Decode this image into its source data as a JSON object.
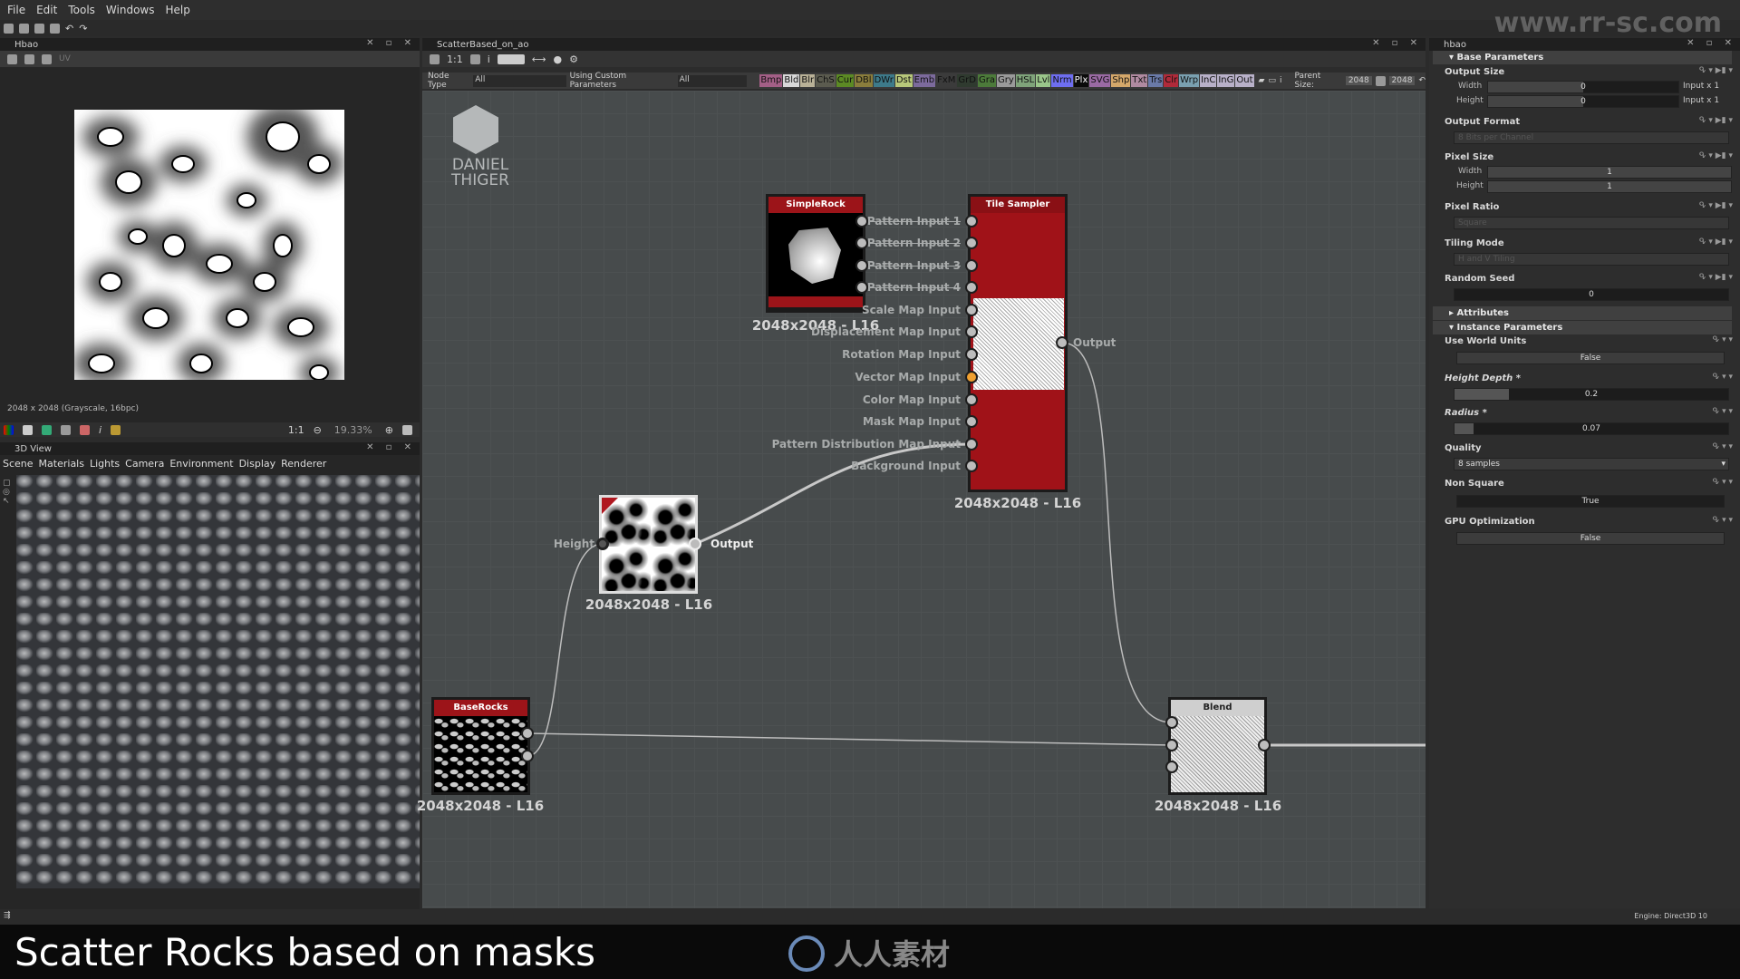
{
  "menu": [
    "File",
    "Edit",
    "Tools",
    "Windows",
    "Help"
  ],
  "left_panel": {
    "title": "Hbao",
    "toolbar_uv": "UV",
    "image_info": "2048 x 2048 (Grayscale, 16bpc)",
    "zoom_ratio": "1:1",
    "zoom_level": "19.33%"
  },
  "view3d": {
    "title": "3D View",
    "menu": [
      "Scene",
      "Materials",
      "Lights",
      "Camera",
      "Environment",
      "Display",
      "Renderer"
    ]
  },
  "graph": {
    "title": "ScatterBased_on_ao",
    "toolbar_ratio": "1:1",
    "node_type_label": "Node Type",
    "node_type_value": "All",
    "custom_params_label": "Using Custom Parameters",
    "custom_params_value": "All",
    "filters": [
      {
        "t": "Bmp",
        "c": "#a35f86"
      },
      {
        "t": "Bld",
        "c": "#d8d8d8"
      },
      {
        "t": "Blr",
        "c": "#b9b197"
      },
      {
        "t": "ChS",
        "c": "#5b5b4f"
      },
      {
        "t": "Cur",
        "c": "#5c8a24"
      },
      {
        "t": "DBl",
        "c": "#8a7d3c"
      },
      {
        "t": "DWr",
        "c": "#3d7a8a"
      },
      {
        "t": "Dst",
        "c": "#b7c77a"
      },
      {
        "t": "Emb",
        "c": "#7c6a9c"
      },
      {
        "t": "FxM",
        "c": "#3b3b3b"
      },
      {
        "t": "GrD",
        "c": "#2f3a2f"
      },
      {
        "t": "Gra",
        "c": "#4c7a3a"
      },
      {
        "t": "Gry",
        "c": "#9a9a9a"
      },
      {
        "t": "HSL",
        "c": "#7fa37a"
      },
      {
        "t": "Lvl",
        "c": "#9ac58a"
      },
      {
        "t": "Nrm",
        "c": "#6e6ef0"
      },
      {
        "t": "Plx",
        "c": "#0a0a0a"
      },
      {
        "t": "SVG",
        "c": "#9a6aa3"
      },
      {
        "t": "Shp",
        "c": "#d4a76a"
      },
      {
        "t": "Txt",
        "c": "#b08aa0"
      },
      {
        "t": "Trs",
        "c": "#6a7aa8"
      },
      {
        "t": "Clr",
        "c": "#b02a3a"
      },
      {
        "t": "Wrp",
        "c": "#7aa0b0"
      },
      {
        "t": "InC",
        "c": "#b8b0c8"
      },
      {
        "t": "InG",
        "c": "#b8b0c8"
      },
      {
        "t": "Out",
        "c": "#b8b0c8"
      }
    ],
    "parent_size_label": "Parent Size:",
    "parent_size": "2048",
    "size2": "2048",
    "logo": "DANIEL THIGER",
    "nodes": {
      "simple_rock": {
        "title": "SimpleRock",
        "res": "2048x2048 - L16"
      },
      "tile_sampler": {
        "title": "Tile Sampler",
        "res": "2048x2048 - L16",
        "inputs": [
          "Pattern Input 1",
          "Pattern Input 2",
          "Pattern Input 3",
          "Pattern Input 4",
          "Scale Map Input",
          "Displacement Map Input",
          "Rotation Map Input",
          "Vector Map Input",
          "Color Map Input",
          "Mask Map Input",
          "Pattern Distribution Map Input",
          "Background Input"
        ],
        "output": "Output"
      },
      "hbao": {
        "input": "Height",
        "output": "Output",
        "res": "2048x2048 - L16"
      },
      "base_rocks": {
        "title": "BaseRocks",
        "res": "2048x2048 - L16"
      },
      "blend": {
        "title": "Blend",
        "res": "2048x2048 - L16"
      }
    }
  },
  "props": {
    "title": "hbao",
    "base_section": "Base Parameters",
    "output_size": "Output Size",
    "width": "Width",
    "height": "Height",
    "width_val": "0",
    "height_val": "0",
    "width_suffix": "Input x 1",
    "height_suffix": "Input x 1",
    "output_format": "Output Format",
    "output_format_val": "8 Bits per Channel",
    "pixel_size": "Pixel Size",
    "px_w": "1",
    "px_h": "1",
    "pixel_ratio": "Pixel Ratio",
    "pixel_ratio_val": "Square",
    "tiling_mode": "Tiling Mode",
    "tiling_mode_val": "H and V Tiling",
    "random_seed": "Random Seed",
    "random_seed_val": "0",
    "attributes": "Attributes",
    "instance_section": "Instance Parameters",
    "use_world_units": "Use World Units",
    "use_world_units_val": "False",
    "height_depth": "Height Depth *",
    "height_depth_val": "0.2",
    "height_depth_frac": 0.2,
    "radius": "Radius *",
    "radius_val": "0.07",
    "radius_frac": 0.07,
    "quality": "Quality",
    "quality_val": "8 samples",
    "non_square": "Non Square",
    "non_square_val": "True",
    "gpu_opt": "GPU Optimization",
    "gpu_opt_val": "False"
  },
  "status": {
    "engine": "Engine: Direct3D 10"
  },
  "caption": "Scatter Rocks based on masks",
  "watermarks": {
    "top_right": "www.rr-sc.com",
    "bottom": "人人素材"
  }
}
